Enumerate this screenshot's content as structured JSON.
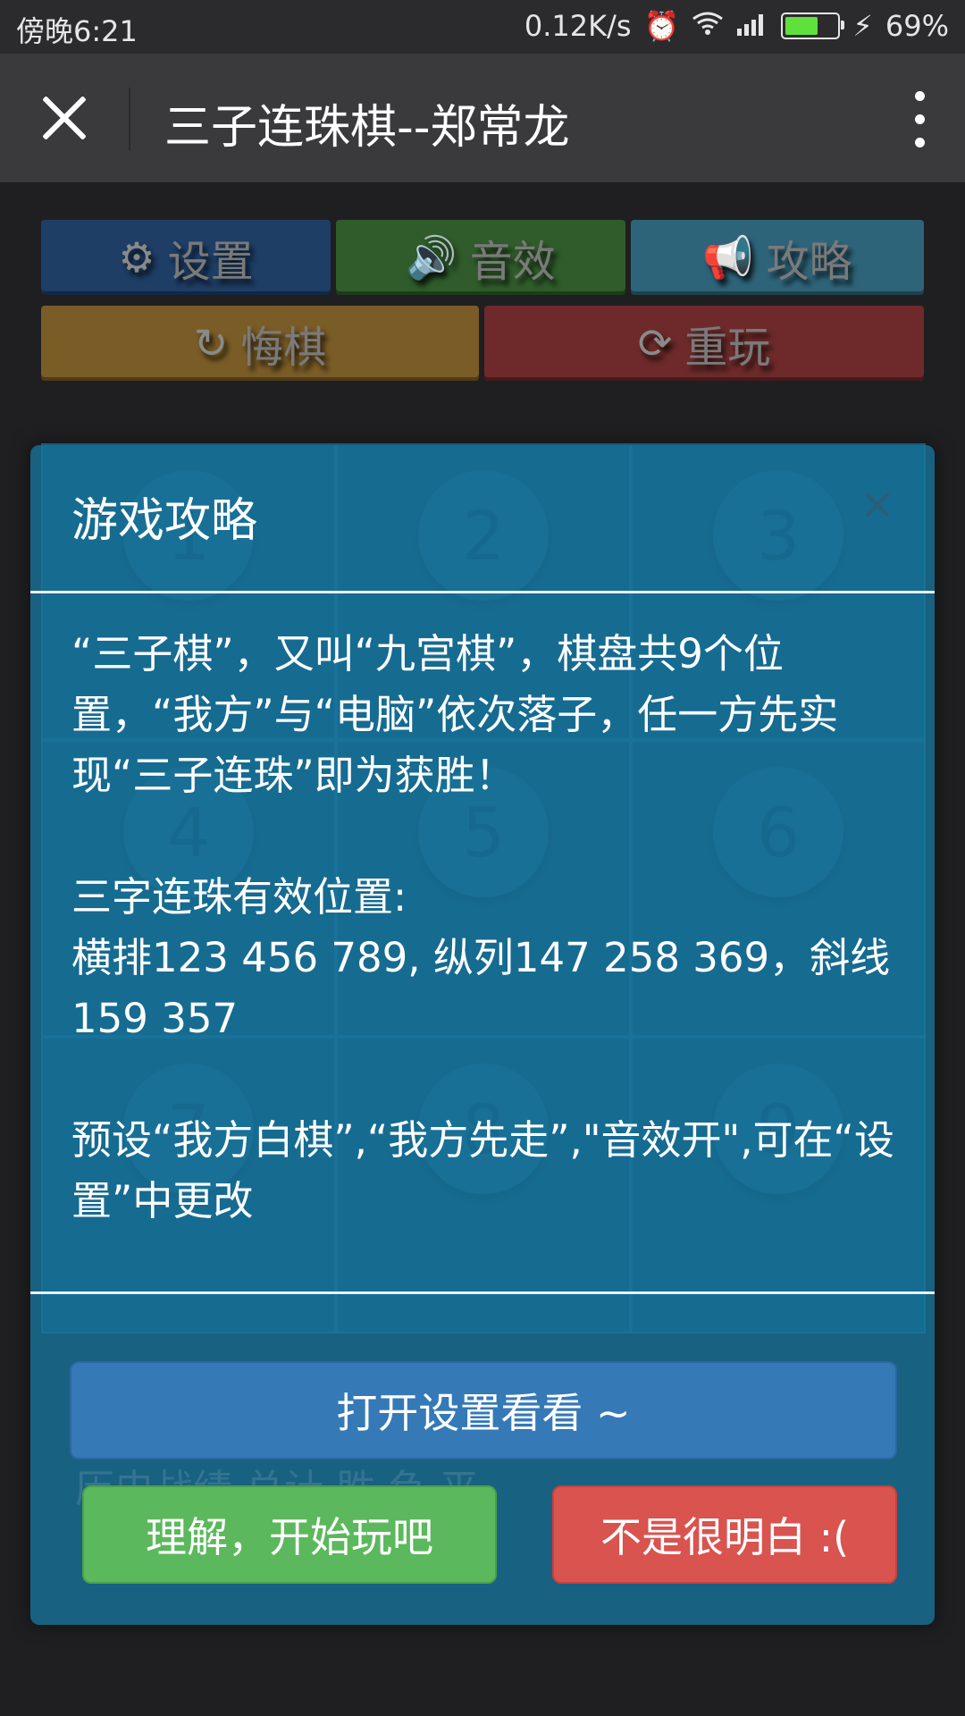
{
  "status_bar": {
    "time": "傍晚6:21",
    "net_speed": "0.12K/s",
    "battery": "69%",
    "battery_level": 0.69
  },
  "title_bar": {
    "title": "三子连珠棋--郑常龙"
  },
  "toolbar": {
    "settings": "设置",
    "sound": "音效",
    "guide": "攻略",
    "undo": "悔棋",
    "replay": "重玩"
  },
  "board": {
    "cells": [
      "1",
      "2",
      "3",
      "4",
      "5",
      "6",
      "7",
      "8",
      "9"
    ],
    "footer_text": "历史战绩  总计    胜    负    平"
  },
  "modal": {
    "title": "游戏攻略",
    "close": "×",
    "para1": "“三子棋”，又叫“九宫棋”，棋盘共9个位置，“我方”与“电脑”依次落子，任一方先实现“三子连珠”即为获胜！",
    "para2_title": "三字连珠有效位置:",
    "para2_body": "横排123 456 789, 纵列147 258 369，斜线159 357",
    "para3": "预设“我方白棋”,“我方先走”,\"音效开\",可在“设置”中更改",
    "btn_open": "打开设置看看 ~",
    "btn_ok": "理解，开始玩吧",
    "btn_no": "不是很明白 :("
  },
  "colors": {
    "settings_btn": "#1e3e66",
    "sound_btn": "#2f5c2a",
    "guide_btn": "#2e6479",
    "undo_btn": "#7a5c26",
    "replay_btn": "#6e2a2a"
  }
}
